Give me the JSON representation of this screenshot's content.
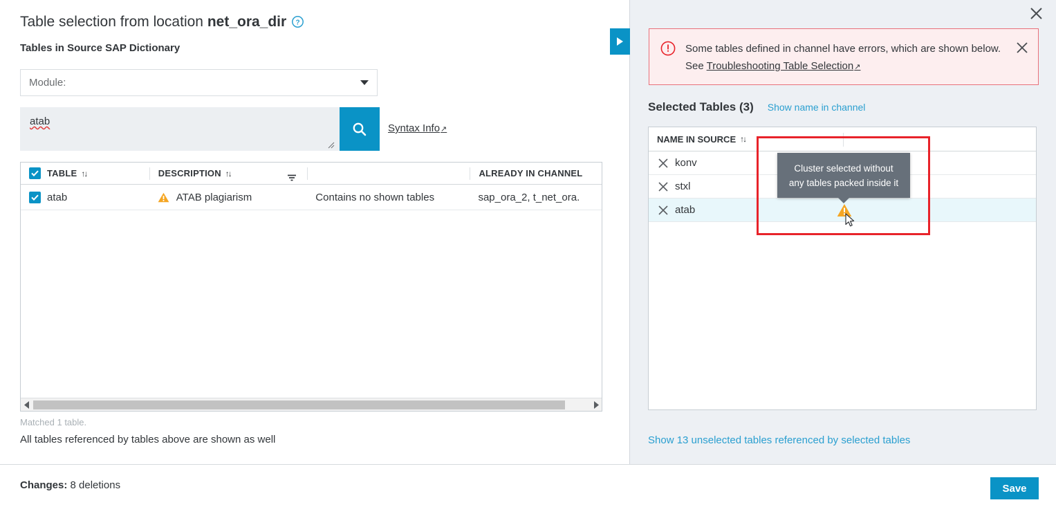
{
  "header": {
    "title_prefix": "Table selection from location ",
    "title_location": "net_ora_dir",
    "help_icon": "help-circle-icon",
    "section_title": "Tables in Source SAP Dictionary"
  },
  "module_select": {
    "label": "Module:",
    "caret_icon": "chevron-down-icon"
  },
  "search": {
    "value": "atab",
    "button_icon": "search-icon",
    "syntax_link": "Syntax Info",
    "external_arrow": "↗"
  },
  "source_table": {
    "columns": [
      {
        "label": "TABLE",
        "sort_icon": "sort-updown-icon"
      },
      {
        "label": "DESCRIPTION",
        "sort_icon": "sort-updown-icon",
        "filter_icon": "filter-icon"
      },
      {
        "label": "",
        "sort_icon": ""
      },
      {
        "label": "ALREADY IN CHANNEL",
        "sort_icon": ""
      }
    ],
    "rows": [
      {
        "checked": true,
        "table": "atab",
        "warning_icon": "warning-triangle-icon",
        "description": "ATAB plagiarism",
        "contains": "Contains no shown tables",
        "already_in_channel": "sap_ora_2, t_net_ora."
      }
    ],
    "header_checkbox_checked": true,
    "scrollbar": {
      "left_arrow_icon": "chevron-left-icon",
      "right_arrow_icon": "chevron-right-icon"
    }
  },
  "footnotes": {
    "matched": "Matched 1 table.",
    "referenced": "All tables referenced by tables above are shown as well"
  },
  "right_panel": {
    "close_icon": "close-icon",
    "collapse_tab_icon": "chevron-right-icon",
    "error": {
      "icon": "error-circle-icon",
      "text_part1": "Some tables defined in channel have errors, which are shown below. See ",
      "link": "Troubleshooting Table Selection",
      "external_arrow": "↗",
      "close_icon": "close-icon"
    },
    "selected": {
      "title": "Selected Tables (3)",
      "show_name_link": "Show name in channel",
      "column_header": "NAME IN SOURCE",
      "sort_icon": "sort-updown-icon",
      "rows": [
        {
          "remove_icon": "close-icon",
          "name": "konv",
          "active": false
        },
        {
          "remove_icon": "close-icon",
          "name": "stxl",
          "active": false
        },
        {
          "remove_icon": "close-icon",
          "name": "atab",
          "active": true
        }
      ]
    },
    "tooltip": {
      "text": "Cluster selected without any tables packed inside it",
      "warning_icon": "warning-triangle-icon",
      "cursor_icon": "mouse-cursor-icon"
    },
    "unselected_link": "Show 13 unselected tables referenced by selected tables"
  },
  "footer": {
    "changes_label": "Changes:",
    "changes_value": " 8 deletions",
    "save_label": "Save"
  },
  "colors": {
    "accent": "#0a93c6",
    "link": "#2a9fd0",
    "error_border": "#e8707a",
    "error_bg": "#fdeeef",
    "error_icon": "#e8232a",
    "warning": "#f5a623",
    "panel_bg": "#edf0f4",
    "highlight_row": "#e8f7fb",
    "redbox": "#e8232a",
    "tooltip_bg": "#67707a"
  }
}
